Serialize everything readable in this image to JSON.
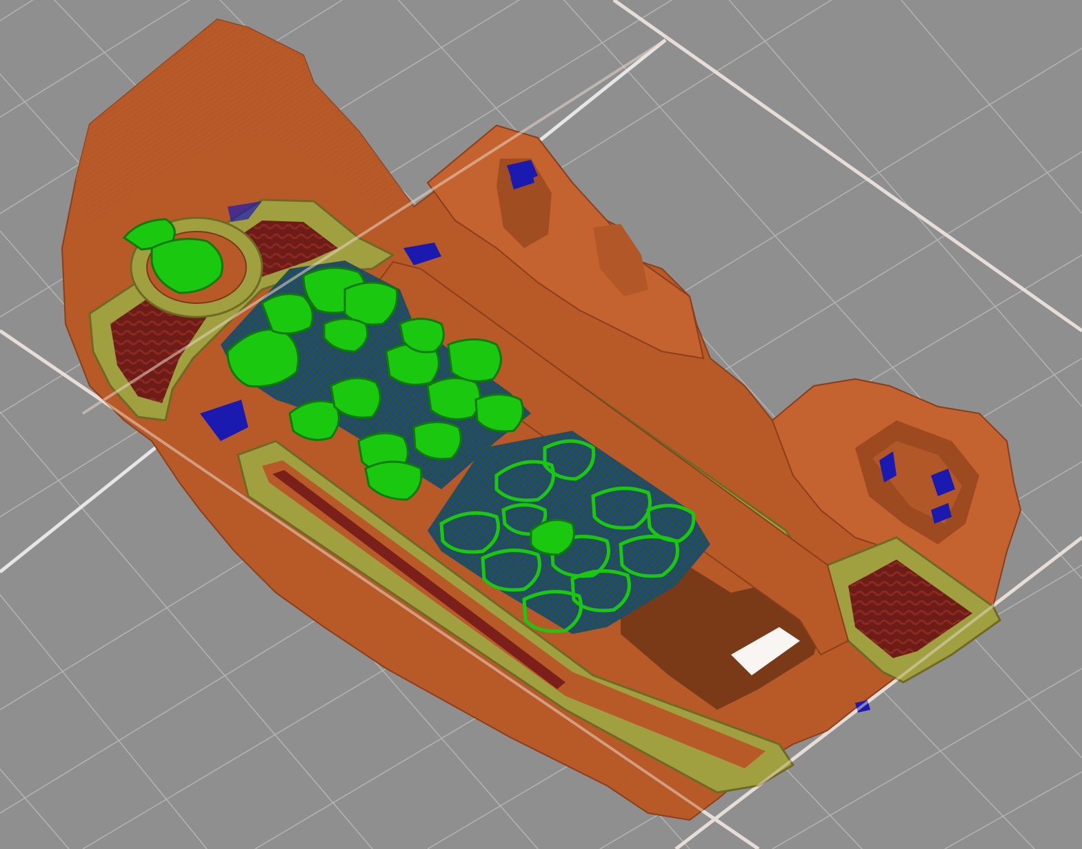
{
  "view": {
    "kind": "sliced print preview",
    "background_color": "#8f8f8f",
    "grid_color_minor": "#b4b4b4",
    "grid_color_major": "#e6e6e6",
    "grid_shown": true
  },
  "legend_colors": {
    "perimeter": "#b85a28",
    "external_perimeter": "#c46330",
    "overhang_perimeter": "#1a1ab0",
    "internal_infill": "#7a1f1a",
    "solid_infill": "#a0a040",
    "top_solid_infill": "#a0a040",
    "support_material": "#19c80f",
    "support_interface": "#1a8f1a",
    "bridge_infill": "#2f2fcc"
  },
  "model": {
    "name_visible": "",
    "feature_regions": [
      "outer-shell",
      "top-frame",
      "internal-infill-pockets",
      "support-columns",
      "support-interface-grid",
      "overhang-edges"
    ]
  }
}
